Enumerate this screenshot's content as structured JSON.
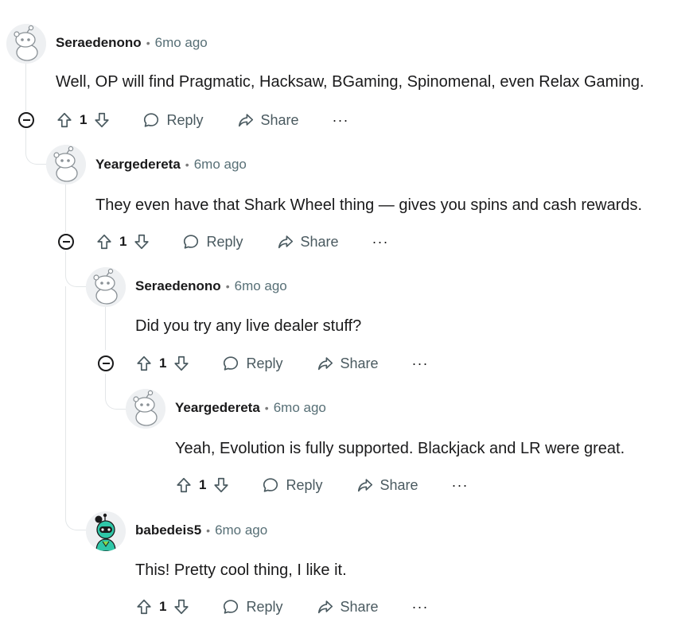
{
  "comments": [
    {
      "author": "Seraedenono",
      "time": "6mo ago",
      "body": "Well, OP will find Pragmatic, Hacksaw, BGaming, Spinomenal, even Relax Gaming.",
      "score": "1",
      "reply_label": "Reply",
      "share_label": "Share",
      "more_label": "···",
      "avatar_icon": "snoo-default-avatar"
    },
    {
      "author": "Yeargedereta",
      "time": "6mo ago",
      "body": "They even have that Shark Wheel thing — gives you spins and cash rewards.",
      "score": "1",
      "reply_label": "Reply",
      "share_label": "Share",
      "more_label": "···",
      "avatar_icon": "snoo-default-avatar"
    },
    {
      "author": "Seraedenono",
      "time": "6mo ago",
      "body": "Did you try any live dealer stuff?",
      "score": "1",
      "reply_label": "Reply",
      "share_label": "Share",
      "more_label": "···",
      "avatar_icon": "snoo-default-avatar"
    },
    {
      "author": "Yeargedereta",
      "time": "6mo ago",
      "body": "Yeah, Evolution is fully supported. Blackjack and LR were great.",
      "score": "1",
      "reply_label": "Reply",
      "share_label": "Share",
      "more_label": "···",
      "avatar_icon": "snoo-default-avatar"
    },
    {
      "author": "babedeis5",
      "time": "6mo ago",
      "body": "This! Pretty cool thing, I like it.",
      "score": "1",
      "reply_label": "Reply",
      "share_label": "Share",
      "more_label": "···",
      "avatar_icon": "snoo-custom-teal-avatar"
    }
  ],
  "separator": "•",
  "colors": {
    "text": "#1a1a1b",
    "meta": "#576f76",
    "action": "#4a5a60",
    "thread_line": "#e3e6e8",
    "custom_avatar_teal": "#2fc7a8"
  }
}
